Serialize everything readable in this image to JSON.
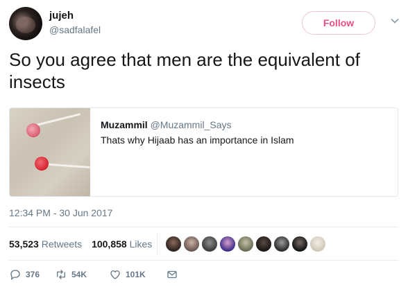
{
  "author": {
    "name": "jujeh",
    "handle": "@sadfalafel",
    "follow_label": "Follow"
  },
  "tweet": {
    "text": "So you agree that men are the equivalent of insects",
    "timestamp": "12:34 PM - 30 Jun 2017"
  },
  "quoted": {
    "name": "Muzammil",
    "handle": "@Muzammil_Says",
    "text": "Thats why Hijaab has an importance in Islam"
  },
  "stats": {
    "retweets_count": "53,523",
    "retweets_label": "Retweets",
    "likes_count": "100,858",
    "likes_label": "Likes"
  },
  "actions": {
    "reply_count": "376",
    "retweet_count": "54K",
    "like_count": "101K"
  },
  "colors": {
    "follow": "#e0245e",
    "muted": "#657786",
    "text": "#14171a",
    "border": "#e6ecf0"
  },
  "icons": [
    "chevron-down-icon",
    "reply-icon",
    "retweet-icon",
    "like-icon",
    "message-icon"
  ]
}
